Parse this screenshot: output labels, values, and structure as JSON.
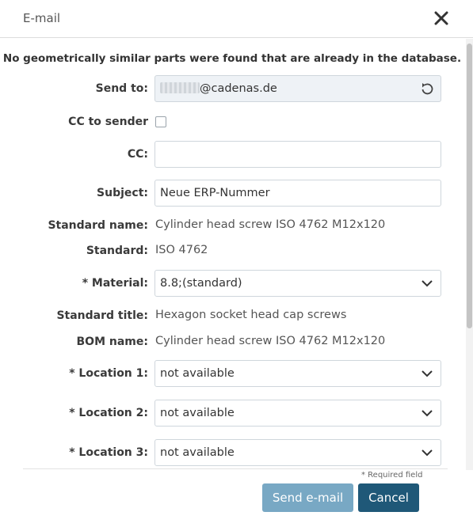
{
  "dialog": {
    "title": "E-mail",
    "notice": "No geometrically similar parts were found that are already in the database.",
    "send_to": {
      "label": "Send to:",
      "value": "@cadenas.de",
      "icon": "reset-icon"
    },
    "cc_to_sender": {
      "label": "CC to sender",
      "checked": false
    },
    "cc": {
      "label": "CC:",
      "value": ""
    },
    "subject": {
      "label": "Subject:",
      "value": "Neue ERP-Nummer"
    },
    "standard_name": {
      "label": "Standard name:",
      "value": "Cylinder head screw ISO 4762 M12x120"
    },
    "standard": {
      "label": "Standard:",
      "value": "ISO 4762"
    },
    "material": {
      "label": "* Material:",
      "value": "8.8;(standard)"
    },
    "standard_title": {
      "label": "Standard title:",
      "value": "Hexagon socket head cap screws"
    },
    "bom_name": {
      "label": "BOM name:",
      "value": "Cylinder head screw ISO 4762 M12x120"
    },
    "location1": {
      "label": "* Location 1:",
      "value": "not available"
    },
    "location2": {
      "label": "* Location 2:",
      "value": "not available"
    },
    "location3": {
      "label": "* Location 3:",
      "value": "not available"
    },
    "required_note": "* Required field",
    "send_label": "Send e-mail",
    "cancel_label": "Cancel"
  },
  "colors": {
    "send_button": "#78a8c4",
    "cancel_button": "#1f5878",
    "readonly_field": "#eef2f6"
  }
}
